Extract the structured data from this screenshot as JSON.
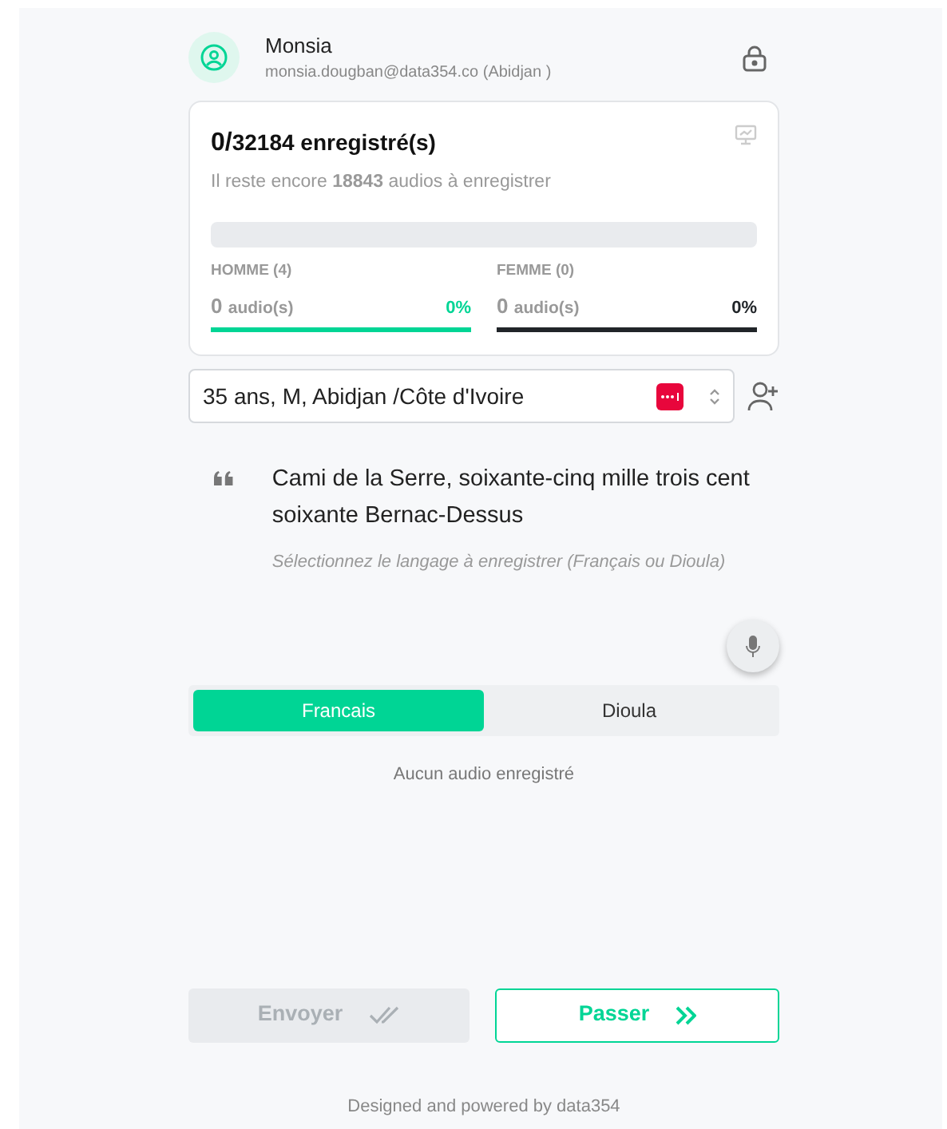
{
  "user": {
    "name": "Monsia",
    "email": "monsia.dougban@data354.co (Abidjan )"
  },
  "stats": {
    "recorded": "0/",
    "total": "32184 enregistré(s)",
    "remaining": "Il reste encore **18843** audios à enregistrer",
    "level": 0,
    "genders": [
      {
        "label": "HOMME (4)",
        "count": "0",
        "unit": "audio(s)",
        "percent": "0%",
        "color": "#00d595"
      },
      {
        "label": "FEMME (0)",
        "count": "0",
        "unit": "audio(s)",
        "percent": "0%",
        "color": "#212529"
      }
    ]
  },
  "speaker_select": {
    "value": "35 ans, M, Abidjan /Côte d'Ivoire"
  },
  "sentence": "Cami de la Serre, soixante-cinq mille trois cent soixante Bernac-Dessus",
  "hint": "Sélectionnez le langage à enregistrer (Français ou Dioula)",
  "languages": [
    {
      "label": "Francais",
      "selected": true
    },
    {
      "label": "Dioula",
      "selected": false
    }
  ],
  "empty_message": "Aucun audio enregistré",
  "buttons": [
    {
      "kind": "send",
      "label": "Envoyer",
      "disabled": true
    },
    {
      "kind": "skip",
      "label": "Passer",
      "disabled": false
    }
  ],
  "footer": "Designed and powered by data354"
}
